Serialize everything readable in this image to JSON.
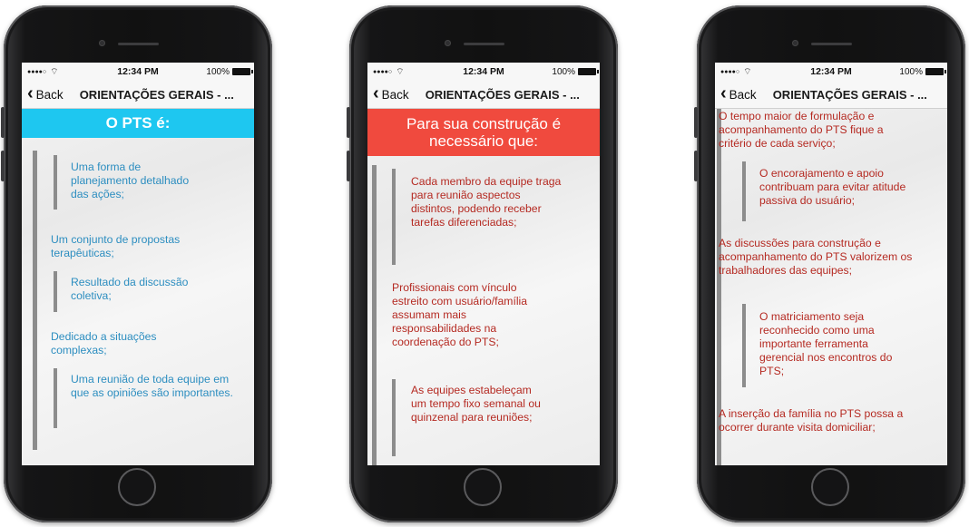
{
  "status_bar": {
    "time": "12:34 PM",
    "battery": "100%"
  },
  "nav": {
    "back_label": "Back",
    "title": "ORIENTAÇÕES GERAIS - ..."
  },
  "screens": [
    {
      "banner": "O PTS é:",
      "banner_color": "#1ec7f0",
      "text_color": "#2d8ec0",
      "items": [
        "Uma forma de planejamento detalhado das ações;",
        "Um conjunto de propostas terapêuticas;",
        "Resultado da discussão coletiva;",
        "Dedicado a situações complexas;",
        "Uma reunião de toda equipe em que as opiniões são importantes."
      ]
    },
    {
      "banner_line1": "Para sua construção é",
      "banner_line2": "necessário que:",
      "banner_color": "#f04a3e",
      "text_color": "#b52a22",
      "items": [
        "Cada membro da equipe traga para reunião aspectos distintos, podendo receber tarefas diferenciadas;",
        "Profissionais com vínculo estreito com usuário/família assumam mais responsabilidades na coordenação do PTS;",
        "As equipes estabeleçam um tempo fixo semanal ou quinzenal para reuniões;"
      ]
    },
    {
      "text_color": "#b52a22",
      "items": [
        "O tempo maior de formulação e acompanhamento do PTS fique a critério de cada serviço;",
        "O encorajamento e apoio contribuam para evitar atitude passiva do usuário;",
        "As discussões para construção e acompanhamento do PTS valorizem os trabalhadores das equipes;",
        "O matriciamento seja reconhecido como uma importante ferramenta gerencial nos encontros do PTS;",
        "A inserção da família no PTS possa a ocorrer durante visita domiciliar;"
      ]
    }
  ]
}
